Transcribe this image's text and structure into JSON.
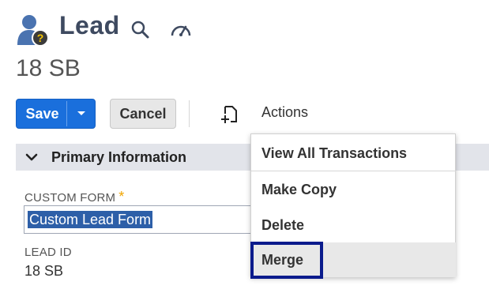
{
  "header": {
    "title": "Lead",
    "record_name": "18 SB",
    "icons": [
      "lead-person-icon",
      "search-icon",
      "dashboard-gauge-icon"
    ]
  },
  "toolbar": {
    "save_label": "Save",
    "cancel_label": "Cancel",
    "actions_label": "Actions"
  },
  "section": {
    "title": "Primary Information"
  },
  "fields": {
    "custom_form": {
      "label": "CUSTOM FORM",
      "required_mark": "*",
      "value": "Custom Lead Form"
    },
    "lead_id": {
      "label": "LEAD ID",
      "value": "18 SB"
    }
  },
  "actions_menu": {
    "items": [
      "View All Transactions",
      "Make Copy",
      "Delete",
      "Merge"
    ]
  },
  "colors": {
    "primary": "#1a6fdc",
    "section_bg": "#e2e4ea",
    "highlight_border": "#0a1b8c",
    "required": "#f0a400"
  }
}
